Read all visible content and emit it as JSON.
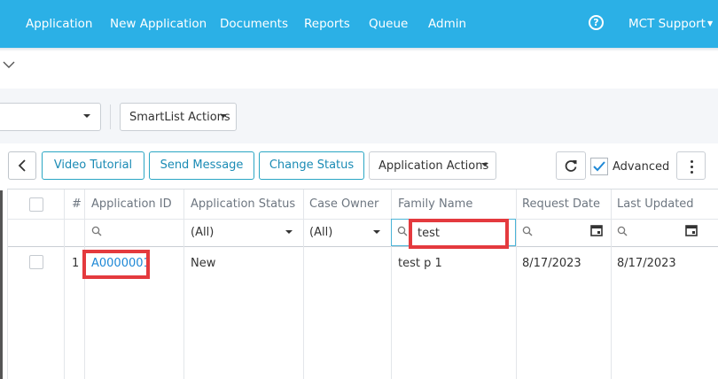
{
  "nav": {
    "items": [
      "Application",
      "New Application",
      "Documents",
      "Reports",
      "Queue",
      "Admin"
    ],
    "help_glyph": "?",
    "user": "MCT Support"
  },
  "toolbar": {
    "smartlist_actions": "SmartList Actions",
    "video_tutorial": "Video Tutorial",
    "send_message": "Send Message",
    "change_status": "Change Status",
    "application_actions": "Application Actions",
    "advanced_label": "Advanced",
    "advanced_checked": true
  },
  "grid": {
    "columns": [
      "#",
      "Application ID",
      "Application Status",
      "Case Owner",
      "Family Name",
      "Request Date",
      "Last Updated"
    ],
    "filters": {
      "application_status": "(All)",
      "case_owner": "(All)",
      "family_name": "test"
    },
    "rows": [
      {
        "num": "1",
        "application_id": "A0000001",
        "application_status": "New",
        "case_owner": "",
        "family_name": "test p 1",
        "request_date": "8/17/2023",
        "last_updated": "8/17/2023"
      }
    ]
  },
  "colors": {
    "nav_bg": "#2bb0e6",
    "accent": "#1a8bb5",
    "highlight": "#e43a3e",
    "link": "#1e88d6"
  }
}
